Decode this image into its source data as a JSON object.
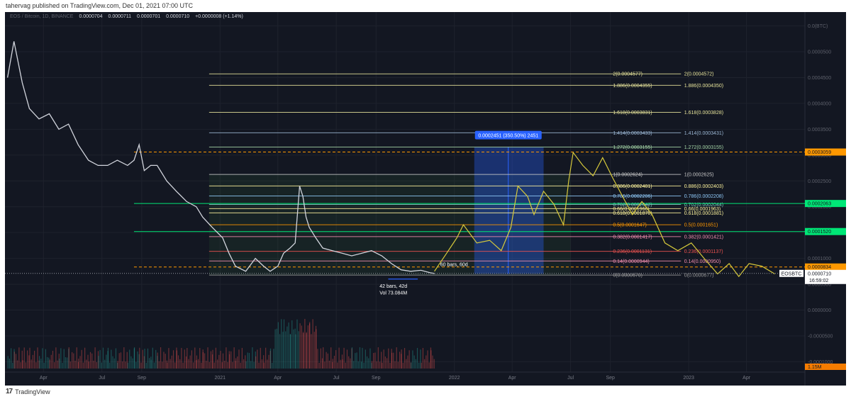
{
  "header": {
    "publish_text": "tahervag published on TradingView.com, Dec 01, 2021 07:00 UTC"
  },
  "footer": {
    "logo_text": "17",
    "brand": "TradingView"
  },
  "ohlc": {
    "symbol": "EOS / Bitcoin, 1D, BINANCE",
    "open": "0.0000704",
    "high": "0.0000711",
    "low": "0.0000701",
    "close": "0.0000710",
    "change": "+0.0000008 (+1.14%)"
  },
  "colors": {
    "background": "#131722",
    "price": "#d1d4dc",
    "up": "#26a69a",
    "down": "#ef5350",
    "projection": "#d6c93b",
    "accent": "#2962ff"
  },
  "chart_data": {
    "type": "line",
    "title": "EOS / Bitcoin, 1D, BINANCE",
    "y_axis": {
      "scale": "linear",
      "currency": "BTC",
      "range": [
        -0.00012,
        0.00057
      ],
      "ticks": [
        0.00055,
        0.0005,
        0.00045,
        0.0004,
        0.00035,
        0.0003,
        0.00025,
        0.0002,
        0.00015,
        0.0001,
        5e-05,
        0,
        -5e-05,
        -0.0001
      ],
      "tick_labels": [
        "0.0(BTC)",
        "0.0000500",
        "0.0004500",
        "0.0004000",
        "0.0003500",
        "0.0003000",
        "0.0002500",
        "0.0002000",
        "0.0001500",
        "0.0001000",
        "0.0000500",
        "0.0000000",
        "-0.0000500",
        "-0.0001000"
      ]
    },
    "x_axis": {
      "ticks": [
        {
          "label": "Apr",
          "date": "2020-04-01"
        },
        {
          "label": "Jul",
          "date": "2020-07-01"
        },
        {
          "label": "Sep",
          "date": "2020-09-01"
        },
        {
          "label": "2021",
          "date": "2021-01-01"
        },
        {
          "label": "Apr",
          "date": "2021-04-01"
        },
        {
          "label": "Jul",
          "date": "2021-07-01"
        },
        {
          "label": "Sep",
          "date": "2021-09-01"
        },
        {
          "label": "2022",
          "date": "2022-01-01"
        },
        {
          "label": "Apr",
          "date": "2022-04-01"
        },
        {
          "label": "Jul",
          "date": "2022-07-01"
        },
        {
          "label": "Sep",
          "date": "2022-09-01"
        },
        {
          "label": "2023",
          "date": "2023-01-01"
        },
        {
          "label": "Apr",
          "date": "2023-04-01"
        }
      ],
      "range": [
        "2020-02-01",
        "2023-07-01"
      ]
    },
    "series": [
      {
        "role": "price",
        "points": [
          [
            "2020-02-05",
            0.00045
          ],
          [
            "2020-02-15",
            0.00052
          ],
          [
            "2020-02-28",
            0.00044
          ],
          [
            "2020-03-10",
            0.00039
          ],
          [
            "2020-03-25",
            0.00037
          ],
          [
            "2020-04-10",
            0.00038
          ],
          [
            "2020-04-25",
            0.00035
          ],
          [
            "2020-05-10",
            0.00036
          ],
          [
            "2020-05-25",
            0.00032
          ],
          [
            "2020-06-10",
            0.00029
          ],
          [
            "2020-06-25",
            0.00028
          ],
          [
            "2020-07-10",
            0.00028
          ],
          [
            "2020-07-25",
            0.00029
          ],
          [
            "2020-08-10",
            0.00028
          ],
          [
            "2020-08-20",
            0.00029
          ],
          [
            "2020-08-28",
            0.00032
          ],
          [
            "2020-09-05",
            0.00027
          ],
          [
            "2020-09-15",
            0.00028
          ],
          [
            "2020-09-25",
            0.00028
          ],
          [
            "2020-10-10",
            0.00025
          ],
          [
            "2020-10-25",
            0.00023
          ],
          [
            "2020-11-10",
            0.00021
          ],
          [
            "2020-11-25",
            0.0002
          ],
          [
            "2020-12-05",
            0.00018
          ],
          [
            "2020-12-20",
            0.00016
          ],
          [
            "2021-01-05",
            0.00014
          ],
          [
            "2021-01-15",
            0.00011
          ],
          [
            "2021-01-25",
            8.5e-05
          ],
          [
            "2021-02-10",
            7.5e-05
          ],
          [
            "2021-02-25",
            0.0001
          ],
          [
            "2021-03-10",
            8.5e-05
          ],
          [
            "2021-03-20",
            7.5e-05
          ],
          [
            "2021-04-01",
            8.5e-05
          ],
          [
            "2021-04-10",
            0.00011
          ],
          [
            "2021-04-20",
            0.00012
          ],
          [
            "2021-04-28",
            0.00013
          ],
          [
            "2021-05-05",
            0.00024
          ],
          [
            "2021-05-10",
            0.00022
          ],
          [
            "2021-05-15",
            0.00018
          ],
          [
            "2021-05-20",
            0.00016
          ],
          [
            "2021-05-30",
            0.00014
          ],
          [
            "2021-06-10",
            0.00012
          ],
          [
            "2021-06-25",
            0.000115
          ],
          [
            "2021-07-10",
            0.00011
          ],
          [
            "2021-07-25",
            0.000105
          ],
          [
            "2021-08-10",
            0.00011
          ],
          [
            "2021-08-25",
            0.000115
          ],
          [
            "2021-09-10",
            0.000105
          ],
          [
            "2021-09-25",
            9e-05
          ],
          [
            "2021-10-10",
            7.8e-05
          ],
          [
            "2021-10-25",
            7.5e-05
          ],
          [
            "2021-11-10",
            7.7e-05
          ],
          [
            "2021-11-25",
            7.2e-05
          ],
          [
            "2021-12-01",
            7.1e-05
          ]
        ]
      },
      {
        "role": "projection",
        "points": [
          [
            "2021-12-01",
            7.5e-05
          ],
          [
            "2021-12-20",
            0.00011
          ],
          [
            "2022-01-05",
            0.00014
          ],
          [
            "2022-01-15",
            0.000165
          ],
          [
            "2022-02-05",
            0.00013
          ],
          [
            "2022-02-25",
            0.000135
          ],
          [
            "2022-03-15",
            0.000115
          ],
          [
            "2022-03-30",
            0.00016
          ],
          [
            "2022-04-10",
            0.00024
          ],
          [
            "2022-04-25",
            0.00022
          ],
          [
            "2022-05-05",
            0.000185
          ],
          [
            "2022-05-20",
            0.00023
          ],
          [
            "2022-06-05",
            0.000205
          ],
          [
            "2022-06-20",
            0.000165
          ],
          [
            "2022-06-28",
            0.00025
          ],
          [
            "2022-07-05",
            0.000305
          ],
          [
            "2022-07-20",
            0.00028
          ],
          [
            "2022-08-05",
            0.00026
          ],
          [
            "2022-08-20",
            0.000295
          ],
          [
            "2022-09-05",
            0.000255
          ],
          [
            "2022-09-20",
            0.00022
          ],
          [
            "2022-10-05",
            0.000185
          ],
          [
            "2022-10-20",
            0.00021
          ],
          [
            "2022-11-05",
            0.000185
          ],
          [
            "2022-11-25",
            0.00013
          ],
          [
            "2022-12-15",
            0.000115
          ],
          [
            "2023-01-05",
            0.00013
          ],
          [
            "2023-01-25",
            0.0001
          ],
          [
            "2023-02-15",
            7e-05
          ],
          [
            "2023-03-05",
            9e-05
          ],
          [
            "2023-03-20",
            6.5e-05
          ],
          [
            "2023-04-05",
            9e-05
          ],
          [
            "2023-04-25",
            8.5e-05
          ],
          [
            "2023-05-15",
            7e-05
          ]
        ]
      }
    ],
    "fib_levels": [
      {
        "ratio": "2",
        "left": "0.0004577",
        "right": "0.0004572",
        "price": 0.0004572,
        "color": "#e6e39a"
      },
      {
        "ratio": "1.886",
        "left": "0.0004355",
        "right": "0.0004350",
        "price": 0.000435,
        "color": "#e6e39a"
      },
      {
        "ratio": "1.618",
        "left": "0.0003831",
        "right": "0.0003828",
        "price": 0.0003828,
        "color": "#e6e39a"
      },
      {
        "ratio": "1.414",
        "left": "0.0003433",
        "right": "0.0003431",
        "price": 0.0003431,
        "color": "#9bb7d4"
      },
      {
        "ratio": "1.272",
        "left": "0.0003155",
        "right": "0.0003155",
        "price": 0.0003155,
        "color": "#a5d6a7"
      },
      {
        "ratio": "1",
        "left": "0.0002624",
        "right": "0.0002625",
        "price": 0.0002625,
        "color": "#c8c8c8"
      },
      {
        "ratio": "0.886",
        "left": "0.0002401",
        "right": "0.0002403",
        "price": 0.0002403,
        "color": "#fff59d"
      },
      {
        "ratio": "0.786",
        "left": "0.0002206",
        "right": "0.0002208",
        "price": 0.0002208,
        "color": "#90caf9"
      },
      {
        "ratio": "0.702",
        "left": "0.0002042",
        "right": "0.0002044",
        "price": 0.0002044,
        "color": "#80cbc4"
      },
      {
        "ratio": "0.66",
        "left": "0.0001960",
        "right": "0.0001963",
        "price": 0.0001963,
        "color": "#fff59d"
      },
      {
        "ratio": "0.618",
        "left": "0.0001878",
        "right": "0.0001881",
        "price": 0.0001881,
        "color": "#fff59d"
      },
      {
        "ratio": "0.5",
        "left": "0.0001647",
        "right": "0.0001651",
        "price": 0.0001651,
        "color": "#ff9800"
      },
      {
        "ratio": "0.382",
        "left": "0.0001417",
        "right": "0.0001421",
        "price": 0.0001421,
        "color": "#f48fb1"
      },
      {
        "ratio": "0.236",
        "left": "0.0001131",
        "right": "0.0001137",
        "price": 0.0001137,
        "color": "#ef5350"
      },
      {
        "ratio": "0.14",
        "left": "0.0000944",
        "right": "0.0000950",
        "price": 9.5e-05,
        "color": "#f48fb1"
      },
      {
        "ratio": "0",
        "left": "0.0000670",
        "right": "0.0000677",
        "price": 6.77e-05,
        "color": "#9e9e9e"
      }
    ],
    "horizontal_levels": [
      {
        "price": 0.0003059,
        "label": "0.0003059",
        "color": "#ff9800",
        "style": "dashed"
      },
      {
        "price": 0.0002063,
        "label": "0.0002063",
        "color": "#00e676",
        "style": "solid"
      },
      {
        "price": 0.000152,
        "label": "0.0001520",
        "color": "#00e676",
        "style": "solid"
      },
      {
        "price": 8.34e-05,
        "label": "0.0000834",
        "color": "#ff9800",
        "style": "dashed"
      }
    ],
    "last_price": {
      "price": 7.1e-05,
      "label": "0.0000710",
      "symbol": "EOSBTC",
      "countdown": "16:59:02"
    },
    "volume_label": "1.15M",
    "annotations": [
      {
        "text": "0.0002451 (350.50%) 2451",
        "kind": "price-range"
      },
      {
        "text": "60 bars, 60d",
        "kind": "date-range"
      },
      {
        "text": "42 bars, 42d",
        "kind": "date-range"
      },
      {
        "text": "Vol 73.084M",
        "kind": "volume"
      }
    ]
  }
}
